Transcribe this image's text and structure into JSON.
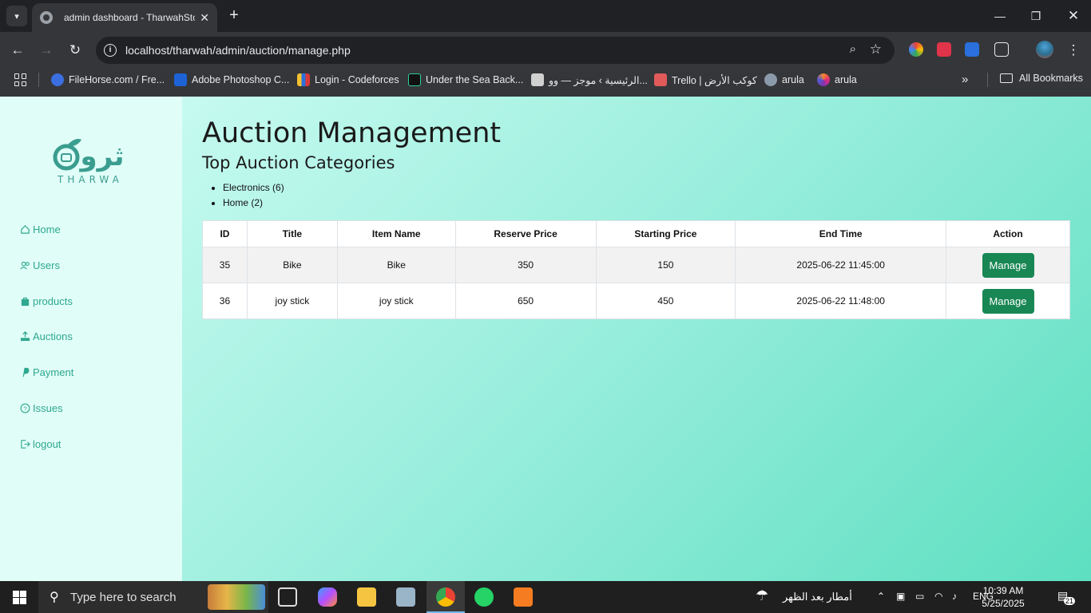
{
  "browser": {
    "tab_title": "admin dashboard - TharwahSto",
    "url": "localhost/tharwah/admin/auction/manage.php",
    "bookmarks": [
      {
        "label": "FileHorse.com / Fre...",
        "color": "#3b6fe0"
      },
      {
        "label": "Adobe Photoshop C...",
        "color": "#1e63d6"
      },
      {
        "label": "Login - Codeforces",
        "color": "#f2c12e"
      },
      {
        "label": "Under the Sea Back...",
        "color": "#111111"
      },
      {
        "label": "الرئيسية › موجز — وو...",
        "color": "#d0d0d0"
      },
      {
        "label": "Trello | كوكب الأرض",
        "color": "#e05a5a"
      },
      {
        "label": "arula",
        "color": "#8a9aaa"
      },
      {
        "label": "arula",
        "color": "#c04fd0"
      }
    ],
    "all_bookmarks": "All Bookmarks"
  },
  "brand": {
    "logo_text": "ثروة",
    "wordmark": "THARWA",
    "color": "#3a9d8f"
  },
  "sidebar": {
    "items": [
      {
        "label": "Home",
        "icon": "home-icon"
      },
      {
        "label": "Users",
        "icon": "users-icon"
      },
      {
        "label": "products",
        "icon": "bag-icon"
      },
      {
        "label": "Auctions",
        "icon": "auction-icon"
      },
      {
        "label": "Payment",
        "icon": "paypal-icon"
      },
      {
        "label": "Issues",
        "icon": "question-icon"
      },
      {
        "label": "logout",
        "icon": "logout-icon"
      }
    ]
  },
  "main": {
    "title": "Auction Management",
    "categories_title": "Top Auction Categories",
    "categories": [
      "Electronics (6)",
      "Home (2)"
    ],
    "table": {
      "headers": [
        "ID",
        "Title",
        "Item Name",
        "Reserve Price",
        "Starting Price",
        "End Time",
        "Action"
      ],
      "rows": [
        {
          "id": "35",
          "title": "Bike",
          "item_name": "Bike",
          "reserve_price": "350",
          "starting_price": "150",
          "end_time": "2025-06-22 11:45:00",
          "action": "Manage"
        },
        {
          "id": "36",
          "title": "joy stick",
          "item_name": "joy stick",
          "reserve_price": "650",
          "starting_price": "450",
          "end_time": "2025-06-22 11:48:00",
          "action": "Manage"
        }
      ]
    }
  },
  "taskbar": {
    "search_placeholder": "Type here to search",
    "weather": "أمطار بعد الظهر",
    "language": "ENG",
    "time": "10:39 AM",
    "date": "5/25/2025",
    "notifications": "21"
  },
  "colors": {
    "accent_green": "#198754",
    "sidebar_bg": "#e0fdf8",
    "nav_text": "#2ea88e"
  }
}
